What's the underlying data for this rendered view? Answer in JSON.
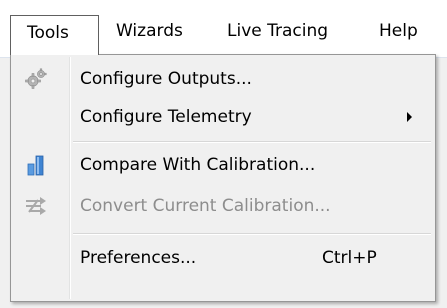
{
  "menubar": {
    "items": [
      {
        "label": "Tools"
      },
      {
        "label": "Wizards"
      },
      {
        "label": "Live Tracing"
      },
      {
        "label": "Help"
      }
    ]
  },
  "tools_menu": {
    "items": [
      {
        "label": "Configure Outputs...",
        "icon": "gears-icon",
        "enabled": true
      },
      {
        "label": "Configure Telemetry",
        "has_submenu": true,
        "enabled": true
      },
      {
        "label": "Compare With Calibration...",
        "icon": "bar-chart-icon",
        "enabled": true
      },
      {
        "label": "Convert Current Calibration...",
        "icon": "convert-arrows-icon",
        "enabled": false
      },
      {
        "label": "Preferences...",
        "shortcut": "Ctrl+P",
        "enabled": true
      }
    ]
  },
  "colors": {
    "menubar_background": "#ffffff",
    "menu_background": "#f0f0f0",
    "disabled_text": "#8d8d8d",
    "chart_icon_blue": "#3f84d2"
  }
}
